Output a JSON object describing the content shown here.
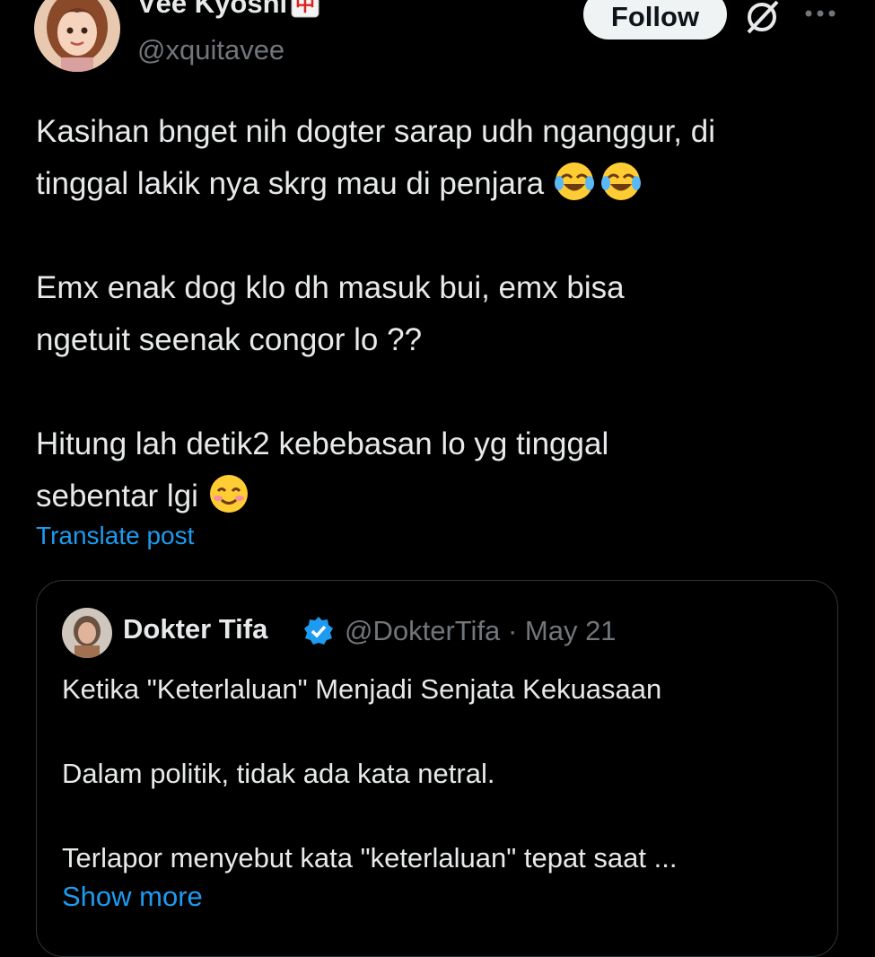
{
  "author": {
    "display_name": "Vëe Kyoshi",
    "handle": "@xquitavee",
    "name_badge_glyph": "中"
  },
  "actions": {
    "follow_label": "Follow",
    "grok_icon": "grok-icon",
    "more_icon": "more-horizontal-icon"
  },
  "post": {
    "lines": [
      "Kasihan bnget nih dogter sarap udh nganggur,  di",
      "tinggal lakik nya skrg mau di penjara",
      "Emx enak dog klo dh masuk bui,  emx bisa",
      "ngetuit seenak congor lo ??",
      "Hitung lah detik2 kebebasan lo yg tinggal",
      "sebentar lgi"
    ],
    "emojis": [
      "face-with-tears-of-joy",
      "face-with-tears-of-joy",
      "smiling-face-with-smiling-eyes"
    ],
    "translate_label": "Translate post"
  },
  "quoted": {
    "display_name": "Dokter Tifa",
    "handle": "@DokterTifa",
    "separator": "·",
    "date": "May 21",
    "lines": [
      "Ketika \"Keterlaluan\" Menjadi Senjata Kekuasaan",
      "Dalam politik, tidak ada kata netral.",
      "Terlapor menyebut kata \"keterlaluan\" tepat saat ..."
    ],
    "show_more_label": "Show more"
  },
  "colors": {
    "background": "#000000",
    "text": "#e7e9ea",
    "secondary": "#71767b",
    "link": "#1d9bf0",
    "border": "#2f3336"
  }
}
